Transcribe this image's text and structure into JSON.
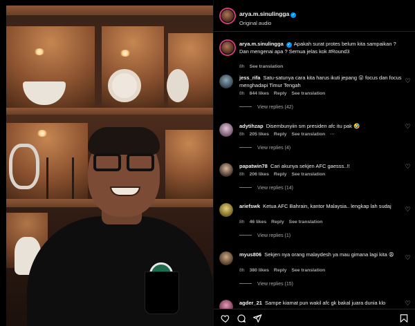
{
  "header": {
    "username": "arya.m.sinulingga",
    "subtitle": "Original audio"
  },
  "caption": {
    "username": "arya.m.sinulingga",
    "text": "Apakah surat protes belum kita sampaikan ? Dan mengenai apa ? Semua jelas kok #Round3",
    "time": "8h",
    "see_translation": "See translation"
  },
  "comments": [
    {
      "username": "jess_rifa",
      "text": "Satu-satunya cara kita harus ikuti jepang 😮 focus dan focus menghadapi Timur Tengah",
      "time": "8h",
      "likes": "844 likes",
      "reply": "Reply",
      "see_translation": "See translation",
      "view_replies": "View replies (42)"
    },
    {
      "username": "adytihzap",
      "text": "Disembunyiin sm presiden afc itu pak 🤣",
      "time": "8h",
      "likes": "205 likes",
      "reply": "Reply",
      "see_translation": "See translation",
      "more": "···",
      "view_replies": "View replies (4)"
    },
    {
      "username": "papatwin78",
      "text": "Cari akunya sekjen AFC gaesss..!!",
      "time": "8h",
      "likes": "206 likes",
      "reply": "Reply",
      "see_translation": "See translation",
      "view_replies": "View replies (14)"
    },
    {
      "username": "ariefswk",
      "text": "Ketua AFC Bahrain, kantor Malaysia.. lengkap lah sudaj",
      "time": "8h",
      "likes": "46 likes",
      "reply": "Reply",
      "see_translation": "See translation",
      "view_replies": "View replies (1)"
    },
    {
      "username": "myus806",
      "text": "Sekjen nya orang malaydesh ya mau gimana lagi kita 😩",
      "time": "8h",
      "likes": "380 likes",
      "reply": "Reply",
      "see_translation": "See translation",
      "view_replies": "View replies (15)"
    },
    {
      "username": "agder_21",
      "text": "Sampe kiamat pun wakil afc gk bakal juara dunia klo",
      "time": "",
      "likes": "",
      "reply": "",
      "see_translation": "",
      "view_replies": ""
    }
  ],
  "icons": {
    "like": "heart-icon",
    "comment": "comment-icon",
    "share": "send-icon",
    "save": "bookmark-icon"
  },
  "colors": {
    "verified": "#0095f6",
    "story_ring": "#d43b7a",
    "meta_text": "#a8a8a8"
  }
}
